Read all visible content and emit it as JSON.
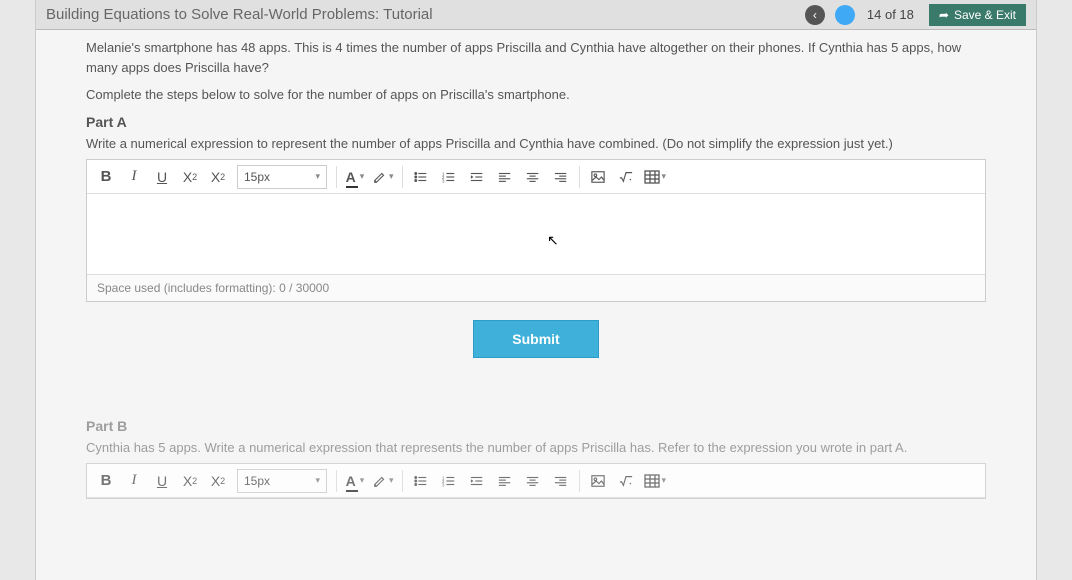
{
  "header": {
    "title": "Building Equations to Solve Real-World Problems: Tutorial",
    "page_current": 14,
    "page_total": 18,
    "page_label": "14  of  18",
    "save_exit": "Save & Exit"
  },
  "problem": {
    "text": "Melanie's smartphone has 48 apps. This is 4 times the number of apps Priscilla and Cynthia have altogether on their phones. If Cynthia has 5 apps, how many apps does Priscilla have?",
    "instruction": "Complete the steps below to solve for the number of apps on Priscilla's smartphone."
  },
  "partA": {
    "label": "Part A",
    "desc": "Write a numerical expression to represent the number of apps Priscilla and Cynthia have combined. (Do not simplify the expression just yet.)",
    "space_used": "Space used (includes formatting): 0 / 30000",
    "submit": "Submit"
  },
  "partB": {
    "label": "Part B",
    "desc": "Cynthia has 5 apps. Write a numerical expression that represents the number of apps Priscilla has. Refer to the expression you wrote in part A."
  },
  "toolbar": {
    "bold": "B",
    "italic": "I",
    "underline": "U",
    "sup_base": "X",
    "sub_base": "X",
    "fontsize": "15px",
    "fontcolor": "A"
  }
}
